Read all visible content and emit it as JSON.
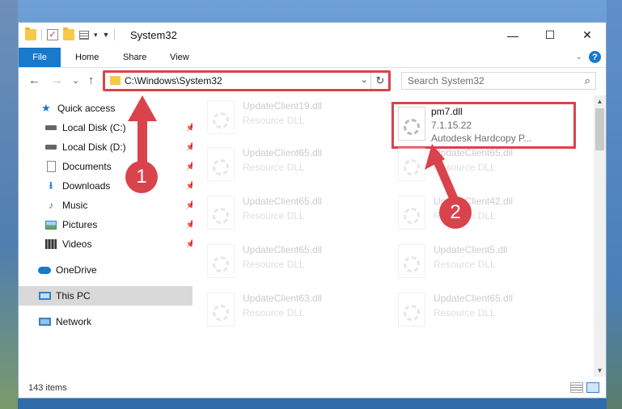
{
  "window": {
    "title": "System32",
    "controls": {
      "minimize": "—",
      "maximize": "☐",
      "close": "✕"
    }
  },
  "ribbon": {
    "tabs": [
      "File",
      "Home",
      "Share",
      "View"
    ],
    "expand_glyph": "⌄",
    "help_glyph": "?"
  },
  "nav": {
    "back": "←",
    "forward": "→",
    "recent": "⌄",
    "up": "↑",
    "address": "C:\\Windows\\System32",
    "address_dropdown": "⌄",
    "refresh": "↻",
    "search_placeholder": "Search System32",
    "search_glyph": "⌕"
  },
  "sidebar": {
    "quick_access": "Quick access",
    "items": [
      {
        "label": "Local Disk (C:)",
        "icon": "disk-icon"
      },
      {
        "label": "Local Disk (D:)",
        "icon": "disk-icon"
      },
      {
        "label": "Documents",
        "icon": "documents-icon"
      },
      {
        "label": "Downloads",
        "icon": "downloads-icon"
      },
      {
        "label": "Music",
        "icon": "music-icon"
      },
      {
        "label": "Pictures",
        "icon": "pictures-icon"
      },
      {
        "label": "Videos",
        "icon": "videos-icon"
      }
    ],
    "onedrive": "OneDrive",
    "this_pc": "This PC",
    "network": "Network",
    "pin_glyph": "📌"
  },
  "files": [
    {
      "name": "UpdateClient19.dll",
      "type": "Resource DLL"
    },
    {
      "name": "pm7.dll",
      "version": "7.1.15.22",
      "company": "Autodesk Hardcopy P..."
    },
    {
      "name": "UpdateClient65.dll",
      "type": "Resource DLL"
    },
    {
      "name": "UpdateClient65.dll",
      "type": "Resource DLL"
    },
    {
      "name": "UpdateClient65.dll",
      "type": "Resource DLL"
    },
    {
      "name": "UpdateClient42.dll",
      "type": "Resource DLL"
    },
    {
      "name": "UpdateClient65.dll",
      "type": "Resource DLL"
    },
    {
      "name": "UpdateClient5.dll",
      "type": "Resource DLL"
    },
    {
      "name": "UpdateClient63.dll",
      "type": "Resource DLL"
    },
    {
      "name": "UpdateClient65.dll",
      "type": "Resource DLL"
    }
  ],
  "status": {
    "item_count": "143 items"
  },
  "annotations": {
    "step1": "1",
    "step2": "2",
    "color": "#d9434b"
  },
  "accent": "#1979ca"
}
